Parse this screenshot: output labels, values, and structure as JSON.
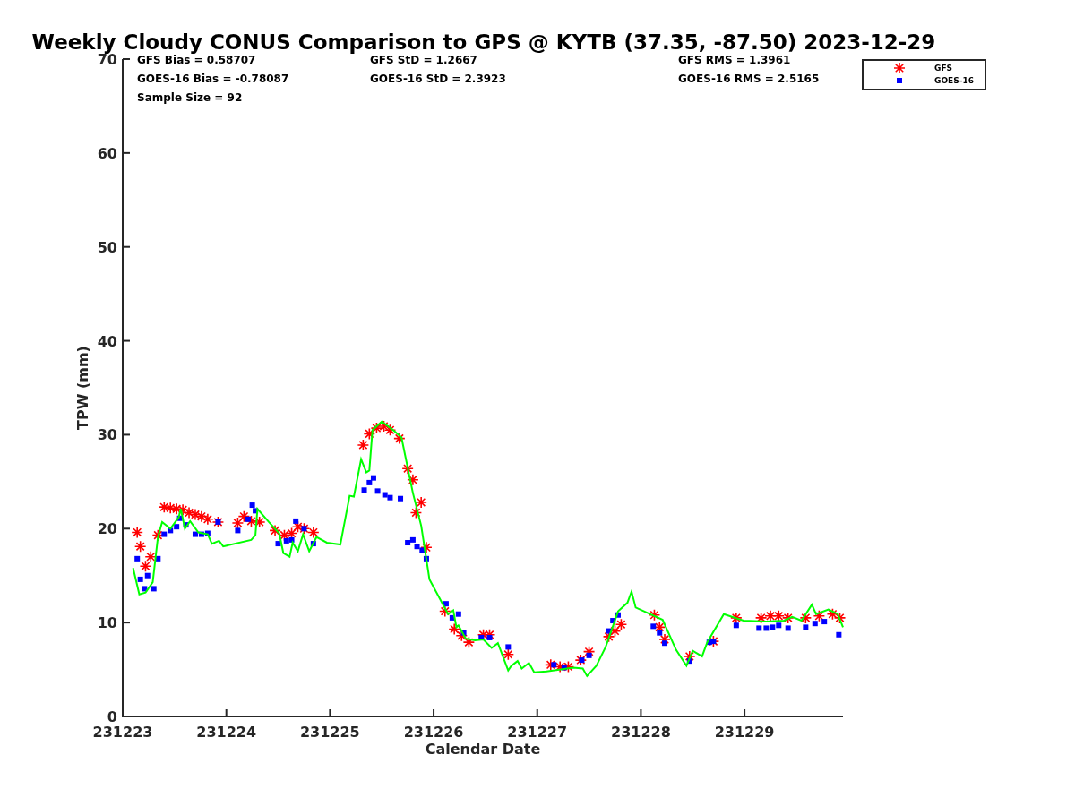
{
  "title": "Weekly Cloudy CONUS Comparison to GPS @ KYTB (37.35, -87.50) 2023-12-29",
  "stat_columns": [
    {
      "lines": [
        "GFS Bias = 0.58707",
        "GOES-16 Bias = -0.78087",
        "Sample Size = 92"
      ]
    },
    {
      "lines": [
        "GFS StD = 1.2667",
        "GOES-16 StD = 2.3923"
      ]
    },
    {
      "lines": [
        "GFS RMS = 1.3961",
        "GOES-16 RMS = 2.5165"
      ]
    }
  ],
  "chart_data": {
    "type": "scatter",
    "xlabel": "Calendar Date",
    "ylabel": "TPW (mm)",
    "xlim": [
      231223,
      231229.95
    ],
    "ylim": [
      0,
      70
    ],
    "xticks": [
      231223,
      231224,
      231225,
      231226,
      231227,
      231228,
      231229
    ],
    "yticks": [
      0,
      10,
      20,
      30,
      40,
      50,
      60,
      70
    ],
    "series": [
      {
        "name": "GFS",
        "color": "#ff0000",
        "x": [
          231223.14,
          231223.17,
          231223.22,
          231223.27,
          231223.34,
          231223.4,
          231223.46,
          231223.52,
          231223.58,
          231223.64,
          231223.7,
          231223.76,
          231223.82,
          231223.92,
          231224.11,
          231224.17,
          231224.24,
          231224.32,
          231224.47,
          231224.56,
          231224.63,
          231224.69,
          231224.75,
          231224.84,
          231225.32,
          231225.38,
          231225.45,
          231225.52,
          231225.58,
          231225.67,
          231225.75,
          231225.8,
          231225.83,
          231225.88,
          231225.93,
          231226.11,
          231226.2,
          231226.27,
          231226.34,
          231226.48,
          231226.54,
          231226.72,
          231227.13,
          231227.22,
          231227.3,
          231227.42,
          231227.5,
          231227.69,
          231227.75,
          231227.81,
          231228.13,
          231228.18,
          231228.23,
          231228.47,
          231228.7,
          231228.92,
          231229.16,
          231229.25,
          231229.33,
          231229.42,
          231229.59,
          231229.72,
          231229.85,
          231229.92
        ],
        "values": [
          19.6,
          18.1,
          16.0,
          17.0,
          19.3,
          22.3,
          22.2,
          22.1,
          22.0,
          21.7,
          21.5,
          21.3,
          21.0,
          20.7,
          20.6,
          21.3,
          20.8,
          20.7,
          19.8,
          19.3,
          19.5,
          20.2,
          20.0,
          19.6,
          28.9,
          30.1,
          30.7,
          30.9,
          30.5,
          29.6,
          26.4,
          25.2,
          21.7,
          22.8,
          18.0,
          11.2,
          9.3,
          8.6,
          7.9,
          8.7,
          8.7,
          6.6,
          5.5,
          5.3,
          5.3,
          6.0,
          6.9,
          8.5,
          9.1,
          9.8,
          10.8,
          9.5,
          8.2,
          6.4,
          8.0,
          10.5,
          10.5,
          10.7,
          10.7,
          10.5,
          10.5,
          10.7,
          10.9,
          10.5
        ]
      },
      {
        "name": "GOES-16",
        "color": "#0000ff",
        "x": [
          231223.14,
          231223.17,
          231223.21,
          231223.24,
          231223.3,
          231223.34,
          231223.4,
          231223.46,
          231223.52,
          231223.55,
          231223.61,
          231223.7,
          231223.76,
          231223.82,
          231223.92,
          231224.11,
          231224.21,
          231224.25,
          231224.28,
          231224.5,
          231224.58,
          231224.63,
          231224.67,
          231224.75,
          231224.84,
          231225.33,
          231225.38,
          231225.42,
          231225.46,
          231225.53,
          231225.58,
          231225.68,
          231225.75,
          231225.8,
          231225.84,
          231225.89,
          231225.93,
          231226.12,
          231226.18,
          231226.24,
          231226.29,
          231226.46,
          231226.54,
          231226.72,
          231227.16,
          231227.26,
          231227.43,
          231227.5,
          231227.69,
          231227.73,
          231227.78,
          231228.12,
          231228.18,
          231228.23,
          231228.47,
          231228.66,
          231228.7,
          231228.92,
          231229.14,
          231229.21,
          231229.27,
          231229.33,
          231229.42,
          231229.59,
          231229.68,
          231229.77,
          231229.91
        ],
        "values": [
          16.8,
          14.6,
          13.6,
          15.0,
          13.6,
          16.8,
          19.4,
          19.8,
          20.2,
          21.1,
          20.4,
          19.4,
          19.4,
          19.5,
          20.7,
          19.8,
          21.0,
          22.5,
          21.9,
          18.4,
          18.7,
          18.8,
          20.8,
          20.0,
          18.4,
          24.1,
          24.9,
          25.4,
          24.0,
          23.6,
          23.3,
          23.2,
          18.5,
          18.8,
          18.1,
          17.7,
          16.8,
          12.0,
          10.5,
          10.9,
          8.9,
          8.4,
          8.4,
          7.4,
          5.5,
          5.2,
          6.0,
          6.5,
          9.1,
          10.2,
          10.8,
          9.6,
          8.9,
          7.8,
          5.9,
          7.9,
          8.0,
          9.7,
          9.4,
          9.4,
          9.5,
          9.7,
          9.4,
          9.5,
          9.9,
          10.1,
          8.7
        ]
      },
      {
        "type": "line",
        "color": "#00ff00",
        "x": [
          231223.1,
          231223.16,
          231223.22,
          231223.29,
          231223.34,
          231223.38,
          231223.46,
          231223.54,
          231223.56,
          231223.6,
          231223.65,
          231223.73,
          231223.82,
          231223.86,
          231223.93,
          231223.97,
          231224.24,
          231224.28,
          231224.3,
          231224.41,
          231224.51,
          231224.55,
          231224.61,
          231224.64,
          231224.69,
          231224.74,
          231224.8,
          231224.87,
          231224.97,
          231225.1,
          231225.19,
          231225.23,
          231225.3,
          231225.35,
          231225.38,
          231225.41,
          231225.5,
          231225.62,
          231225.69,
          231225.8,
          231225.88,
          231225.96,
          231226.14,
          231226.19,
          231226.22,
          231226.24,
          231226.31,
          231226.4,
          231226.48,
          231226.56,
          231226.62,
          231226.72,
          231226.75,
          231226.81,
          231226.85,
          231226.92,
          231226.97,
          231227.09,
          231227.35,
          231227.44,
          231227.48,
          231227.57,
          231227.66,
          231227.78,
          231227.87,
          231227.91,
          231227.95,
          231228.21,
          231228.34,
          231228.44,
          231228.5,
          231228.59,
          231228.64,
          231228.8,
          231228.99,
          231229.21,
          231229.38,
          231229.46,
          231229.55,
          231229.65,
          231229.69,
          231229.81,
          231229.9,
          231229.95
        ],
        "values": [
          15.8,
          13.0,
          13.2,
          14.3,
          19.1,
          20.7,
          20.0,
          21.2,
          22.1,
          20.0,
          20.8,
          19.6,
          19.4,
          18.4,
          18.7,
          18.1,
          18.8,
          19.3,
          22.1,
          20.7,
          19.5,
          17.4,
          17.0,
          18.5,
          17.6,
          19.4,
          17.6,
          19.1,
          18.5,
          18.3,
          23.5,
          23.4,
          27.4,
          26.0,
          26.2,
          30.5,
          31.4,
          30.4,
          29.7,
          23.8,
          20.3,
          14.6,
          10.9,
          11.3,
          9.5,
          9.7,
          8.3,
          8.1,
          8.2,
          7.3,
          7.8,
          4.9,
          5.4,
          5.9,
          5.1,
          5.7,
          4.7,
          4.8,
          5.2,
          5.1,
          4.3,
          5.4,
          7.4,
          11.2,
          12.1,
          13.3,
          11.6,
          10.3,
          7.1,
          5.4,
          7.0,
          6.4,
          7.9,
          10.9,
          10.2,
          10.1,
          10.2,
          10.6,
          10.2,
          11.9,
          10.9,
          11.4,
          10.9,
          9.5
        ]
      }
    ]
  }
}
